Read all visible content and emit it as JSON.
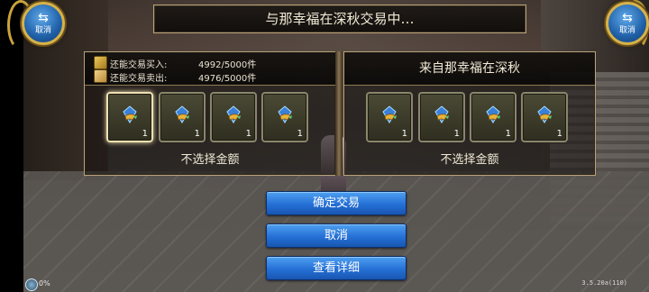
{
  "window": {
    "title": "与那幸福在深秋交易中…"
  },
  "corner_buttons": [
    {
      "label": "取消",
      "icon": "exchange-arrows-icon"
    },
    {
      "label": "取消",
      "icon": "exchange-arrows-icon"
    }
  ],
  "my_side": {
    "buy_label": "还能交易买入:",
    "buy_value": "4992/5000件",
    "sell_label": "还能交易卖出:",
    "sell_value": "4976/5000件",
    "items": [
      {
        "icon": "blue-gem-icon",
        "qty": "1",
        "selected": true
      },
      {
        "icon": "blue-gem-icon",
        "qty": "1",
        "selected": false
      },
      {
        "icon": "blue-gem-icon",
        "qty": "1",
        "selected": false
      },
      {
        "icon": "blue-gem-icon",
        "qty": "1",
        "selected": false
      }
    ],
    "amount_text": "不选择金额"
  },
  "their_side": {
    "from_label": "来自那幸福在深秋",
    "items": [
      {
        "icon": "blue-gem-icon",
        "qty": "1"
      },
      {
        "icon": "blue-gem-icon",
        "qty": "1"
      },
      {
        "icon": "blue-gem-icon",
        "qty": "1"
      },
      {
        "icon": "blue-gem-icon",
        "qty": "1"
      }
    ],
    "amount_text": "不选择金额"
  },
  "actions": {
    "confirm": "确定交易",
    "cancel": "取消",
    "details": "查看详细"
  },
  "status": {
    "percent": "0%",
    "version": "3.5.20a(110)"
  },
  "colors": {
    "button_blue": "#2570d6",
    "frame_gold": "#b8a37a",
    "text": "#f2ead6"
  }
}
